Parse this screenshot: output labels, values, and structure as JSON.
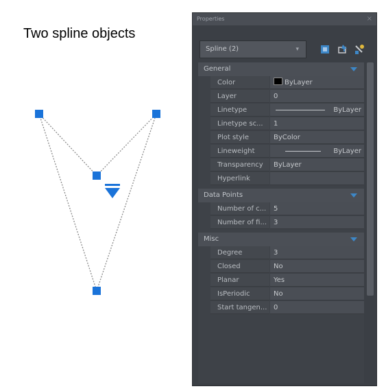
{
  "caption": "Two spline objects",
  "palette": {
    "title": "Properties",
    "close": "×",
    "selection": "Spline (2)",
    "toolbar_icons": [
      "toggle-pickadd-icon",
      "select-objects-icon",
      "quick-select-icon"
    ]
  },
  "sections": {
    "general": {
      "title": "General",
      "rows": [
        {
          "key": "Color",
          "value": "ByLayer"
        },
        {
          "key": "Layer",
          "value": "0"
        },
        {
          "key": "Linetype",
          "value": "ByLayer"
        },
        {
          "key": "Linetype sc...",
          "value": "1"
        },
        {
          "key": "Plot style",
          "value": "ByColor"
        },
        {
          "key": "Lineweight",
          "value": "ByLayer"
        },
        {
          "key": "Transparency",
          "value": "ByLayer"
        },
        {
          "key": "Hyperlink",
          "value": ""
        }
      ]
    },
    "data_points": {
      "title": "Data Points",
      "rows": [
        {
          "key": "Number of c...",
          "value": "5"
        },
        {
          "key": "Number of fi...",
          "value": "3"
        }
      ]
    },
    "misc": {
      "title": "Misc",
      "rows": [
        {
          "key": "Degree",
          "value": "3"
        },
        {
          "key": "Closed",
          "value": "No"
        },
        {
          "key": "Planar",
          "value": "Yes"
        },
        {
          "key": "IsPeriodic",
          "value": "No"
        },
        {
          "key": "Start tangen...",
          "value": "0"
        }
      ]
    }
  },
  "colors": {
    "grip": "#1a73d9",
    "spline": "#8a8a8a",
    "panel": "#3b3f45"
  }
}
